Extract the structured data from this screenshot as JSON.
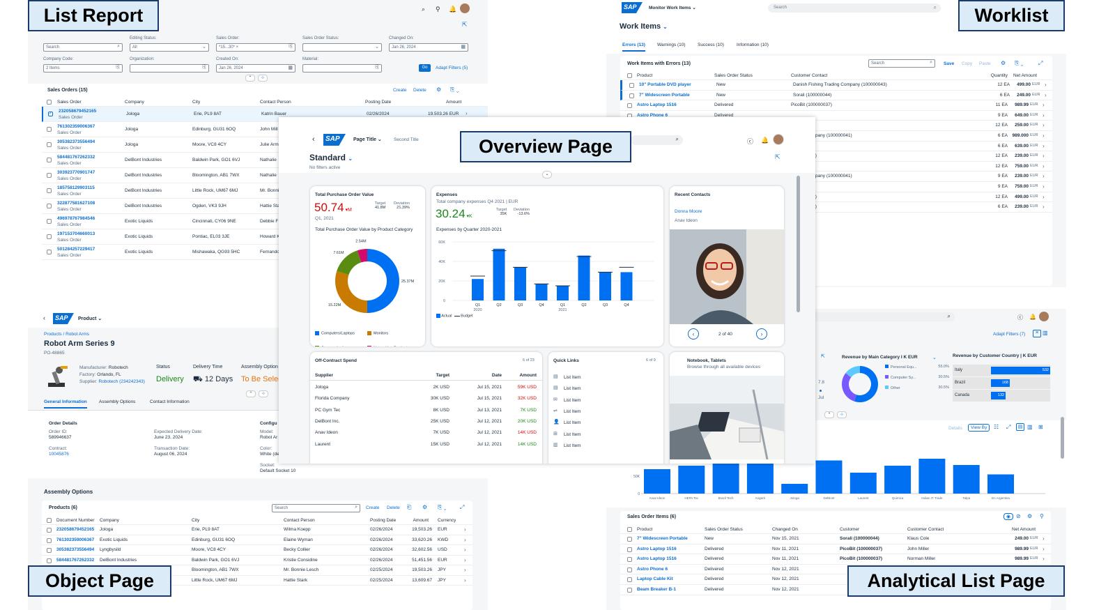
{
  "tags": {
    "list_report": "List Report",
    "worklist": "Worklist",
    "overview": "Overview Page",
    "object": "Object Page",
    "alp": "Analytical List Page"
  },
  "colors": {
    "brand": "#0a6ed1",
    "bar": "#0070f2",
    "negative": "#d20a0a",
    "positive": "#188918",
    "critical": "#e9730c"
  },
  "list_report": {
    "filters": [
      {
        "label": "",
        "value": "Search"
      },
      {
        "label": "Editing Status:",
        "value": "All"
      },
      {
        "label": "Sales Order:",
        "value": "*15...30* ×"
      },
      {
        "label": "Sales Order Status:",
        "value": ""
      },
      {
        "label": "Changed On:",
        "value": "Jan 26, 2024"
      },
      {
        "label": "Company Code:",
        "value": "2 Items"
      },
      {
        "label": "Organization:",
        "value": ""
      },
      {
        "label": "Created On:",
        "value": "Jan 26, 2024"
      },
      {
        "label": "Material:",
        "value": ""
      }
    ],
    "go": "Go",
    "adapt": "Adapt Filters (5)",
    "table_title": "Sales Orders (15)",
    "create": "Create",
    "delete": "Delete",
    "columns": [
      "Sales Order",
      "Company",
      "City",
      "Contact Person",
      "Posting Date",
      "Amount"
    ],
    "sub": "Sales Order",
    "rows": [
      {
        "id": "232058679452165",
        "company": "Jologa",
        "city": "Erie, PL9 8AT",
        "contact": "Katrin Bauer",
        "date": "02/26/2024",
        "amount": "19.503.26 EUR"
      },
      {
        "id": "761302359006367",
        "company": "Jologa",
        "city": "Edinburg, GU31 6OQ",
        "contact": "John Mill"
      },
      {
        "id": "305382373556494",
        "company": "Jologa",
        "city": "Moore, VC8 4CY",
        "contact": "Julie Arm"
      },
      {
        "id": "584481767262332",
        "company": "DelBont Industries",
        "city": "Baldwin Park, GO1 6VJ",
        "contact": "Nathalie"
      },
      {
        "id": "303923770901747",
        "company": "DelBont Industries",
        "city": "Bloomington, AB1 7WX",
        "contact": "Nathalie"
      },
      {
        "id": "185758129903115",
        "company": "DelBont Industries",
        "city": "Little Rock, UM67 6MJ",
        "contact": "Mr. Bonni"
      },
      {
        "id": "322877581627108",
        "company": "DelBont Industries",
        "city": "Ogden, VK3 9JH",
        "contact": "Hattie Sta"
      },
      {
        "id": "496978767984546",
        "company": "Exotic Liquids",
        "city": "Cincinnati, CY06 9NE",
        "contact": "Debbie F"
      },
      {
        "id": "197153704660013",
        "company": "Exotic Liquids",
        "city": "Pontiac, EL03 3JE",
        "contact": "Howard K"
      },
      {
        "id": "501284257229417",
        "company": "Exotic Liquids",
        "city": "Mishawaka, QG93 5HC",
        "contact": "Fernando"
      }
    ]
  },
  "worklist": {
    "app": "Monitor Work Items",
    "search": "Search",
    "title": "Work Items",
    "tabs": [
      "Errors (13)",
      "Warnings (10)",
      "Success (10)",
      "Information (10)"
    ],
    "table_title": "Work Items with Errors (13)",
    "save": "Save",
    "copy": "Copy",
    "paste": "Paste",
    "columns": [
      "Product",
      "Sales Order Status",
      "Customer Contact",
      "Quantity",
      "Net Amount"
    ],
    "rows": [
      {
        "product": "10\" Portable DVD player",
        "status": "New",
        "contact": "Danish Fishing Trading Company (100000043)",
        "qty": "12 EA",
        "amount": "499.00",
        "cur": "EUR"
      },
      {
        "product": "7\" Widescreen Portable",
        "status": "New",
        "contact": "Sorali (100000044)",
        "qty": "6 EA",
        "amount": "249.00",
        "cur": "EUR"
      },
      {
        "product": "Astro Laptop 1516",
        "status": "Delivered",
        "contact": "PicoBit (100000037)",
        "qty": "11 EA",
        "amount": "989.99",
        "cur": "EUR"
      },
      {
        "product": "Astro Phone 6",
        "status": "Delivered",
        "contact": "",
        "qty": "9 EA",
        "amount": "649.00",
        "cur": "EUR"
      },
      {
        "product": "",
        "status": "",
        "contact": "00000042)",
        "qty": "12 EA",
        "amount": "259.00",
        "cur": "EUR"
      },
      {
        "product": "",
        "status": "",
        "contact": "ican IT Company (100000041)",
        "qty": "6 EA",
        "amount": "989.000",
        "cur": "EUR"
      },
      {
        "product": "",
        "status": "",
        "contact": "00000037)",
        "qty": "6 EA",
        "amount": "639.00",
        "cur": "EUR"
      },
      {
        "product": "",
        "status": "",
        "contact": "(100000054)",
        "qty": "12 EA",
        "amount": "239.00",
        "cur": "EUR"
      },
      {
        "product": "",
        "status": "",
        "contact": "00000042)",
        "qty": "12 EA",
        "amount": "759.00",
        "cur": "EUR"
      },
      {
        "product": "",
        "status": "",
        "contact": "ican IT Company (100000041)",
        "qty": "9 EA",
        "amount": "239.00",
        "cur": "EUR"
      },
      {
        "product": "",
        "status": "",
        "contact": "00000037)",
        "qty": "9 EA",
        "amount": "759.00",
        "cur": "EUR"
      },
      {
        "product": "",
        "status": "",
        "contact": "(100000054)",
        "qty": "12 EA",
        "amount": "499.00",
        "cur": "EUR"
      },
      {
        "product": "",
        "status": "",
        "contact": "(100000055)",
        "qty": "6 EA",
        "amount": "239.00",
        "cur": "EUR"
      }
    ]
  },
  "overview": {
    "page_title": "Page Title",
    "second_title": "Second Title",
    "variant": "Standard",
    "no_filters": "No filters active",
    "card1": {
      "title": "Total Purchase Order Value",
      "value": "50.74",
      "unit": "M",
      "period": "Q1, 2021",
      "target_label": "Target",
      "target": "41.8M",
      "dev_label": "Deviation",
      "dev": "21.39%",
      "subtitle": "Total Purchase Order Value by Product Category",
      "donut": [
        {
          "label": "25.37M",
          "value": 25.37,
          "color": "#0070f2"
        },
        {
          "label": "15.22M",
          "value": 15.22,
          "color": "#c87b00"
        },
        {
          "label": "7.61M",
          "value": 7.61,
          "color": "#5b8c12"
        },
        {
          "label": "2.54M",
          "value": 2.54,
          "color": "#d10b6d"
        }
      ],
      "legend": [
        "Computers/Laptops",
        "Monitors",
        "Communication",
        "Networking Products"
      ]
    },
    "card2": {
      "title": "Expenses",
      "subtitle": "Total company expenses Q4 2021 | EUR",
      "value": "30.24",
      "unit": "K",
      "target_label": "Target",
      "target": "35K",
      "dev_label": "Deviation",
      "dev": "-13.6%",
      "chart_title": "Expenses by Quarter 2020-2021",
      "legend_actual": "Actual",
      "legend_budget": "Budget"
    },
    "card3": {
      "title": "Recent Contacts",
      "name": "Donna Moore",
      "sub": "Anav Ideon",
      "pager": "2 of 40"
    },
    "card4": {
      "title": "Off-Contract Spend",
      "count": "6 of 23",
      "columns": [
        "Supplier",
        "Target",
        "Date",
        "Amount"
      ],
      "rows": [
        {
          "supplier": "Jologa",
          "target": "2K USD",
          "date": "Jul 15, 2021",
          "amount": "59K USD",
          "state": "neg"
        },
        {
          "supplier": "Florida Company",
          "target": "30K USD",
          "date": "Jul 15, 2021",
          "amount": "32K USD",
          "state": "neg"
        },
        {
          "supplier": "PC Gym Tec",
          "target": "8K USD",
          "date": "Jul 13, 2021",
          "amount": "7K USD",
          "state": "pos"
        },
        {
          "supplier": "DelBont Inc.",
          "target": "25K USD",
          "date": "Jul 12, 2021",
          "amount": "20K USD",
          "state": "pos"
        },
        {
          "supplier": "Anav Ideon",
          "target": "7K USD",
          "date": "Jul 12, 2021",
          "amount": "14K USD",
          "state": "neg"
        },
        {
          "supplier": "Laurent",
          "target": "15K USD",
          "date": "Jul 12, 2021",
          "amount": "14K USD",
          "state": "pos"
        }
      ]
    },
    "card5": {
      "title": "Quick Links",
      "count": "6 of 9",
      "item": "List Item"
    },
    "card6": {
      "title": "Notebook, Tablets",
      "subtitle": "Browse through all available devices"
    }
  },
  "chart_data": [
    {
      "type": "bar",
      "title": "Expenses by Quarter 2020-2021",
      "categories": [
        "Q1 2020",
        "Q2",
        "Q3",
        "Q4",
        "Q1 2021",
        "Q2",
        "Q3",
        "Q4"
      ],
      "series": [
        {
          "name": "Actual",
          "values": [
            22000,
            53000,
            34000,
            17000,
            15000,
            46000,
            29000,
            29000
          ]
        },
        {
          "name": "Budget",
          "values": [
            25000,
            51000,
            34000,
            17000,
            15000,
            45000,
            29000,
            34000
          ]
        }
      ],
      "ylim": [
        0,
        60000
      ],
      "yticks": [
        "0",
        "20K",
        "40K",
        "60K"
      ]
    },
    {
      "type": "pie",
      "title": "Total Purchase Order Value by Product Category",
      "categories": [
        "Computers/Laptops",
        "Monitors",
        "Communication",
        "Networking Products"
      ],
      "values": [
        25.37,
        15.22,
        7.61,
        2.54
      ]
    },
    {
      "type": "bar",
      "categories": [
        "Anav Ideon",
        "HEPA Tec",
        "Brazil Tech",
        "Angeré",
        "Jologa",
        "DelBont",
        "Laurent",
        "Quimica",
        "Indian IT Trade",
        "Talpa",
        "En Argentina"
      ],
      "values": [
        70000,
        80000,
        95000,
        90000,
        28000,
        95000,
        60000,
        80000,
        100000,
        82000,
        55000
      ],
      "ylim": [
        0,
        100000
      ],
      "yticks": [
        "0",
        "50K",
        "100K"
      ]
    }
  ],
  "object_page": {
    "app": "Product",
    "breadcrumb": "Products / Robot Arms",
    "title": "Robot Arm Series 9",
    "id": "PO-48865",
    "manufacturer_label": "Manufacturer:",
    "manufacturer": "Robotech",
    "factory_label": "Factory:",
    "factory": "Orlando, FL",
    "supplier_label": "Supplier:",
    "supplier": "Robotech (234242343)",
    "status_label": "Status",
    "status": "Delivery",
    "delivery_label": "Delivery Time",
    "delivery": "12 Days",
    "assembly_label": "Assembly Option",
    "assembly": "To Be Selec",
    "tabs": [
      "General Information",
      "Assembly Options",
      "Contact Information"
    ],
    "order_details": "Order Details",
    "order_id_label": "Order ID:",
    "order_id": "589946637",
    "exp_label": "Expected Delivery Date:",
    "exp": "June 23, 2024",
    "contract_label": "Contract:",
    "contract": "10045876",
    "trans_label": "Transaction Date:",
    "trans": "August 06, 2024",
    "config": "Configu",
    "model_label": "Model:",
    "model": "Robot Ar",
    "color_label": "Color:",
    "color": "White (de",
    "socket_label": "Socket:",
    "socket": "Default Socket 10",
    "section": "Assembly Options",
    "table_title": "Products (6)",
    "search": "Search",
    "create": "Create",
    "delete": "Delete",
    "columns": [
      "Document Number",
      "Company",
      "City",
      "Contact Person",
      "Posting Date",
      "Amount",
      "Currency"
    ],
    "rows": [
      {
        "id": "232058679452165",
        "company": "Jologa",
        "city": "Erie, PL9 8AT",
        "contact": "Wilma Koepp",
        "date": "02/26/2024",
        "amount": "19,503.26",
        "cur": "EUR"
      },
      {
        "id": "761302359006367",
        "company": "Exotic Liquids",
        "city": "Edinburg, GU31 6OQ",
        "contact": "Elaine Wyman",
        "date": "02/26/2024",
        "amount": "33,620.26",
        "cur": "KWD"
      },
      {
        "id": "305382373556494",
        "company": "Lyngbysild",
        "city": "Moore, VC8 4CY",
        "contact": "Becky Collier",
        "date": "02/26/2024",
        "amount": "32,602.56",
        "cur": "USD"
      },
      {
        "id": "584481767262332",
        "company": "DelBont Industries",
        "city": "Baldwin Park, GO1 6VJ",
        "contact": "Kristie Considine",
        "date": "02/26/2024",
        "amount": "51,451.56",
        "cur": "EUR"
      },
      {
        "id": "",
        "company": "",
        "city": "Bloomington, AB1 7WX",
        "contact": "Mr. Bonnie Lesch",
        "date": "02/25/2024",
        "amount": "19,503.26",
        "cur": "JPY"
      },
      {
        "id": "",
        "company": "",
        "city": "Little Rock, UM67 6MJ",
        "contact": "Hattie Stark",
        "date": "02/25/2024",
        "amount": "13,609.67",
        "cur": "JPY"
      }
    ]
  },
  "alp": {
    "adapt": "Adapt Filters (7)",
    "card1_title": "Revenue by Main Category I K EUR",
    "card2_title": "Revenue by Customer Country | K EUR",
    "donut_legend": [
      {
        "label": "Personal Equ...",
        "pct": "55.0%"
      },
      {
        "label": "Computer Sy...",
        "pct": "30.5%"
      },
      {
        "label": "Other",
        "pct": "30.5%"
      }
    ],
    "mini_value": "7.8",
    "mini_sub": "Jul",
    "countries": [
      {
        "name": "Italy",
        "value": 532
      },
      {
        "name": "Brazil",
        "value": 168
      },
      {
        "name": "Canada",
        "value": 132
      }
    ],
    "details": "Details",
    "view_by": "View By",
    "table_title": "Sales Order Items (6)",
    "columns": [
      "Product",
      "Sales Order Status",
      "Changed On",
      "Customer",
      "Customer Contact",
      "Net Amount"
    ],
    "rows": [
      {
        "product": "7\" Widescreen Portable",
        "status": "New",
        "changed": "Nov 15, 2021",
        "customer": "Sorali (100000044)",
        "contact": "Klaus Cole",
        "amount": "249.00",
        "cur": "EUR"
      },
      {
        "product": "Astro Laptop 1516",
        "status": "Delivered",
        "changed": "Nov 11, 2021",
        "customer": "PicoBit (100000037)",
        "contact": "John Miller",
        "amount": "989.99",
        "cur": "EUR"
      },
      {
        "product": "Astro Laptop 1516",
        "status": "Delivered",
        "changed": "Nov 11, 2021",
        "customer": "PicoBit (100000037)",
        "contact": "Norman Miller",
        "amount": "989.99",
        "cur": "EUR"
      },
      {
        "product": "Astro Phone 6",
        "status": "Delivered",
        "changed": "Nov 12, 2021",
        "customer": "",
        "contact": "",
        "amount": "",
        "cur": ""
      },
      {
        "product": "Laptop Cable Kit",
        "status": "Delivered",
        "changed": "Nov 12, 2021",
        "customer": "",
        "contact": "",
        "amount": "",
        "cur": ""
      },
      {
        "product": "Beam Breaker B-1",
        "status": "Delivered",
        "changed": "Nov 12, 2021",
        "customer": "",
        "contact": "",
        "amount": "",
        "cur": ""
      }
    ]
  },
  "brand": "SAP"
}
